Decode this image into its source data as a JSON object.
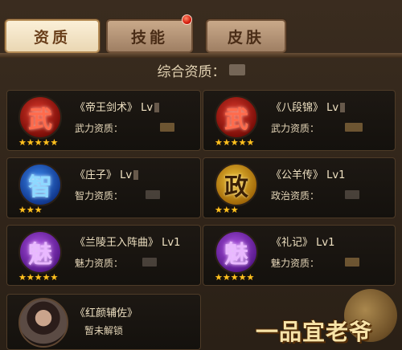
{
  "tabs": [
    {
      "label": "资质",
      "active": true
    },
    {
      "label": "技能",
      "active": false,
      "badge": true
    },
    {
      "label": "皮肤",
      "active": false
    }
  ],
  "summary": {
    "label": "综合资质："
  },
  "cards": [
    {
      "glyph": "武",
      "name": "《帝王剑术》",
      "level": "Lv",
      "attr": "武力资质：",
      "stars": "★★★★★",
      "color": "red"
    },
    {
      "glyph": "武",
      "name": "《八段锦》",
      "level": "Lv",
      "attr": "武力资质：",
      "stars": "★★★★★",
      "color": "red"
    },
    {
      "glyph": "智",
      "name": "《庄子》",
      "level": "Lv",
      "attr": "智力资质：",
      "stars": "★★★",
      "color": "blue"
    },
    {
      "glyph": "政",
      "name": "《公羊传》",
      "level": "Lv1",
      "attr": "政治资质：",
      "stars": "★★★",
      "color": "gold"
    },
    {
      "glyph": "魅",
      "name": "《兰陵王入阵曲》",
      "level": "Lv1",
      "attr": "魅力资质：",
      "stars": "★★★★★",
      "color": "purple"
    },
    {
      "glyph": "魅",
      "name": "《礼记》",
      "level": "Lv1",
      "attr": "魅力资质：",
      "stars": "★★★★★",
      "color": "purple"
    }
  ],
  "companion": {
    "name": "《红颜辅佐》",
    "status": "暂未解锁"
  },
  "logo": {
    "text": "一品宜老爷"
  }
}
